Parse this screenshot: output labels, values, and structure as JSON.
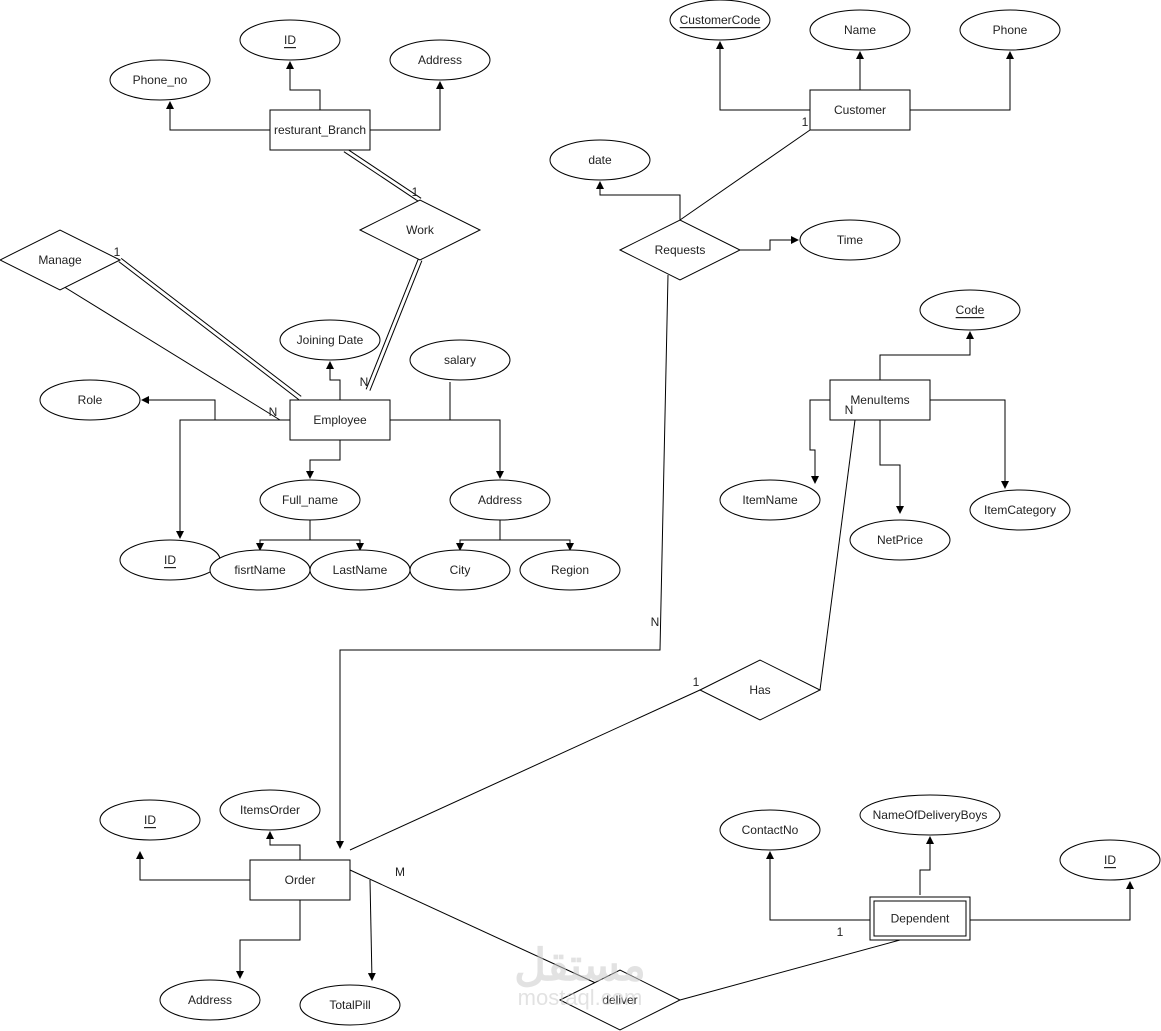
{
  "entities": [
    {
      "key": "branch",
      "label": "resturant_Branch"
    },
    {
      "key": "employee",
      "label": "Employee"
    },
    {
      "key": "customer",
      "label": "Customer"
    },
    {
      "key": "menuitems",
      "label": "MenuItems"
    },
    {
      "key": "order",
      "label": "Order"
    },
    {
      "key": "dependent",
      "label": "Dependent",
      "weak": true
    }
  ],
  "relationships": [
    {
      "key": "work",
      "label": "Work"
    },
    {
      "key": "manage",
      "label": "Manage"
    },
    {
      "key": "requests",
      "label": "Requests"
    },
    {
      "key": "has",
      "label": "Has"
    },
    {
      "key": "deliver",
      "label": "deliver"
    }
  ],
  "attributes": [
    {
      "key": "branch-id",
      "label": "ID",
      "key_attr": true
    },
    {
      "key": "branch-phone",
      "label": "Phone_no"
    },
    {
      "key": "branch-address",
      "label": "Address"
    },
    {
      "key": "emp-joining",
      "label": "Joining Date"
    },
    {
      "key": "emp-salary",
      "label": "salary"
    },
    {
      "key": "emp-role",
      "label": "Role"
    },
    {
      "key": "emp-fullname",
      "label": "Full_name"
    },
    {
      "key": "emp-address",
      "label": "Address"
    },
    {
      "key": "emp-id",
      "label": "ID",
      "key_attr": true
    },
    {
      "key": "emp-firstname",
      "label": "fisrtName"
    },
    {
      "key": "emp-lastname",
      "label": "LastName"
    },
    {
      "key": "emp-city",
      "label": "City"
    },
    {
      "key": "emp-region",
      "label": "Region"
    },
    {
      "key": "cust-code",
      "label": "CustomerCode",
      "key_attr": true
    },
    {
      "key": "cust-name",
      "label": "Name"
    },
    {
      "key": "cust-phone",
      "label": "Phone"
    },
    {
      "key": "req-date",
      "label": "date"
    },
    {
      "key": "req-time",
      "label": "Time"
    },
    {
      "key": "menu-code",
      "label": "Code",
      "key_attr": true
    },
    {
      "key": "menu-itemname",
      "label": "ItemName"
    },
    {
      "key": "menu-netprice",
      "label": "NetPrice"
    },
    {
      "key": "menu-category",
      "label": "ItemCategory"
    },
    {
      "key": "order-id",
      "label": "ID",
      "key_attr": true
    },
    {
      "key": "order-itemsorder",
      "label": "ItemsOrder"
    },
    {
      "key": "order-address",
      "label": "Address"
    },
    {
      "key": "order-totalpill",
      "label": "TotalPill"
    },
    {
      "key": "dep-contact",
      "label": "ContactNo"
    },
    {
      "key": "dep-names",
      "label": "NameOfDeliveryBoys"
    },
    {
      "key": "dep-id",
      "label": "ID",
      "partial_key": true
    }
  ],
  "cardinalities": [
    "1",
    "N",
    "1",
    "N",
    "1",
    "N",
    "1",
    "N",
    "M",
    "1"
  ],
  "watermark": {
    "arabic": "مستقل",
    "latin": "mostaql.com"
  }
}
